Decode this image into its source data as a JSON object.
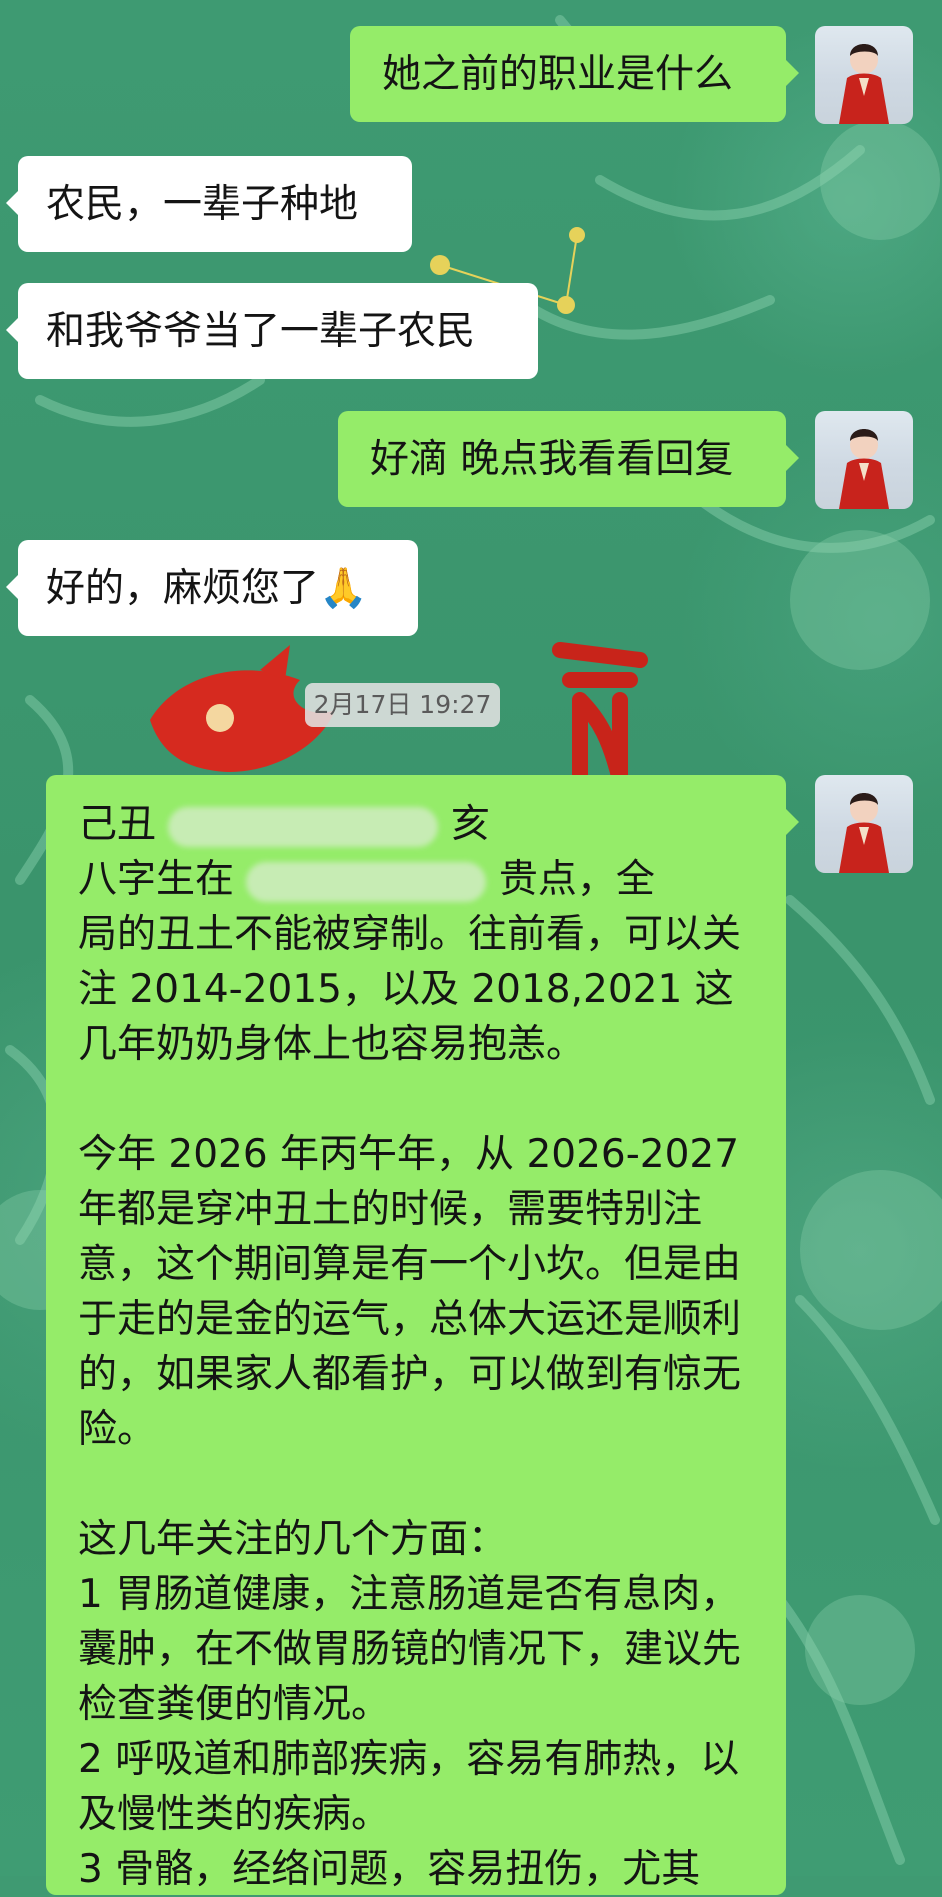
{
  "colors": {
    "background": "#3f9a72",
    "incoming_bubble": "#ffffff",
    "outgoing_bubble": "#95ec69",
    "text": "#141414"
  },
  "messages": [
    {
      "direction": "out",
      "text": "她之前的职业是什么"
    },
    {
      "direction": "in",
      "text": "农民，一辈子种地"
    },
    {
      "direction": "in",
      "text": "和我爷爷当了一辈子农民"
    },
    {
      "direction": "out",
      "text": "好滴 晚点我看看回复"
    },
    {
      "direction": "in",
      "text": "好的，麻烦您了🙏"
    }
  ],
  "timestamp": "2月17日 19:27",
  "long_message": {
    "line1_start": "己丑",
    "line1_end": "亥",
    "line2_start": "八字生在",
    "line2_end": "贵点，全",
    "paragraph1_rest": "局的丑土不能被穿制。往前看，可以关注 2014-2015，以及 2018,2021 这几年奶奶身体上也容易抱恙。",
    "paragraph2": "今年 2026 年丙午年，从 2026-2027 年都是穿冲丑土的时候，需要特别注意，这个期间算是有一个小坎。但是由于走的是金的运气，总体大运还是顺利的，如果家人都看护，可以做到有惊无险。",
    "paragraph3_title": "这几年关注的几个方面：",
    "item1": "1 胃肠道健康，注意肠道是否有息肉，囊肿，在不做胃肠镜的情况下，建议先检查粪便的情况。",
    "item2": "2 呼吸道和肺部疾病，容易有肺热，以及慢性类的疾病。",
    "item3": "3 骨骼，经络问题，容易扭伤，尤其"
  },
  "avatar_icon": "woman-in-red-hanfu-avatar"
}
